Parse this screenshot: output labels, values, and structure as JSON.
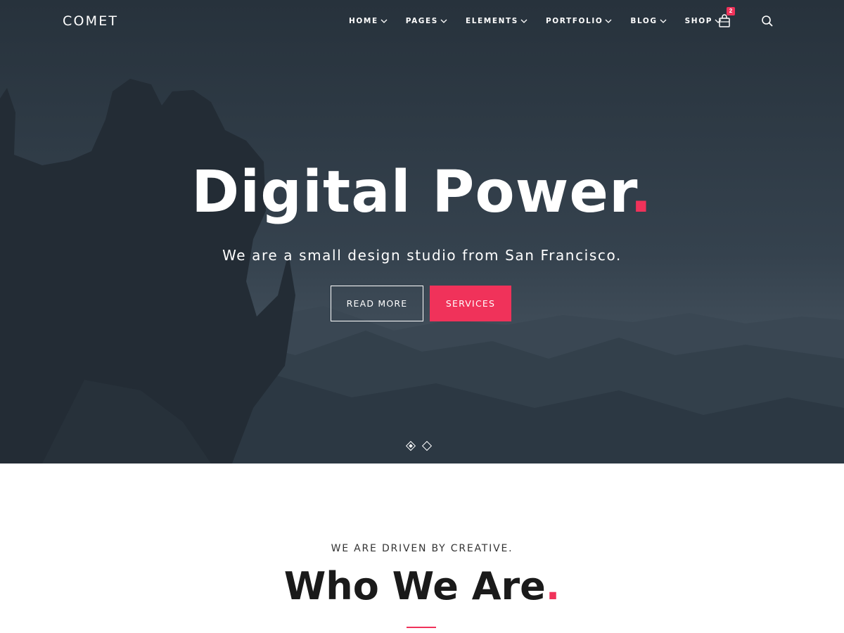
{
  "brand": {
    "logo": "COMET"
  },
  "nav": {
    "items": [
      {
        "label": "HOME"
      },
      {
        "label": "PAGES"
      },
      {
        "label": "ELEMENTS"
      },
      {
        "label": "PORTFOLIO"
      },
      {
        "label": "BLOG"
      },
      {
        "label": "SHOP"
      }
    ],
    "cart_count": "2",
    "icons": {
      "cart": "shopping-bag-icon",
      "search": "search-icon",
      "chevron": "chevron-down-icon"
    }
  },
  "hero": {
    "title": "Digital Power",
    "title_dot": ".",
    "subtitle": "We are a small design studio from San Francisco.",
    "buttons": {
      "read_more": "READ MORE",
      "services": "SERVICES"
    },
    "slider": {
      "total": 2,
      "active": 1
    }
  },
  "about": {
    "kicker": "WE ARE DRIVEN BY CREATIVE.",
    "title": "Who We Are",
    "title_dot": "."
  },
  "colors": {
    "accent": "#f0325a",
    "hero_overlay": "#2f3b46",
    "text_dark": "#1a1a1a"
  }
}
